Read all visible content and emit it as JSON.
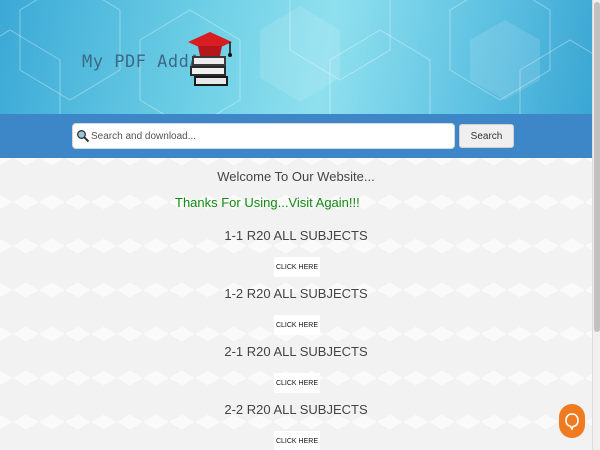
{
  "header": {
    "logo_text": "My PDF AddA"
  },
  "search": {
    "placeholder": "Search and download...",
    "button_label": "Search"
  },
  "main": {
    "welcome": "Welcome To Our Website...",
    "thanks": "Thanks For Using...Visit Again!!!",
    "subjects": [
      {
        "title": "1-1 R20 ALL SUBJECTS",
        "button": "CLICK HERE"
      },
      {
        "title": "1-2 R20 ALL SUBJECTS",
        "button": "CLICK HERE"
      },
      {
        "title": "2-1 R20 ALL SUBJECTS",
        "button": "CLICK HERE"
      },
      {
        "title": "2-2 R20 ALL SUBJECTS",
        "button": "CLICK HERE"
      }
    ]
  },
  "colors": {
    "header_band": "#3d87c9",
    "thanks_text": "#118a11",
    "chat_bubble": "#f07a1f"
  },
  "icons": {
    "search": "magnifier-icon",
    "logo": "graduation-cap-books-icon",
    "chat": "chat-bubble-icon"
  }
}
